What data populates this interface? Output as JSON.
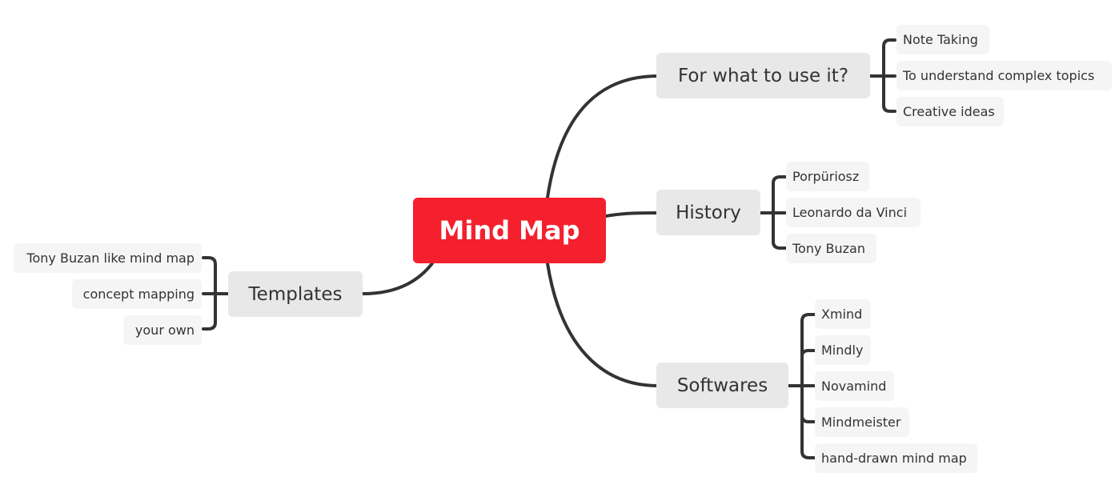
{
  "central": {
    "label": "Mind Map",
    "color": "#f5202e"
  },
  "branches": [
    {
      "id": "for-what",
      "label": "For what to use it?",
      "children": [
        "Note Taking",
        "To understand complex topics",
        "Creative ideas"
      ]
    },
    {
      "id": "history",
      "label": "History",
      "children": [
        "Porpüriosz",
        "Leonardo da Vinci",
        "Tony Buzan"
      ]
    },
    {
      "id": "softwares",
      "label": "Softwares",
      "children": [
        "Xmind",
        "Mindly",
        "Novamind",
        "Mindmeister",
        "hand-drawn mind map"
      ]
    },
    {
      "id": "templates",
      "label": "Templates",
      "children": [
        "Tony Buzan like mind map",
        "concept mapping",
        "your own"
      ]
    }
  ],
  "colors": {
    "line": "#333333",
    "main_fill": "#e8e8e8",
    "sub_fill": "#f5f5f5"
  }
}
